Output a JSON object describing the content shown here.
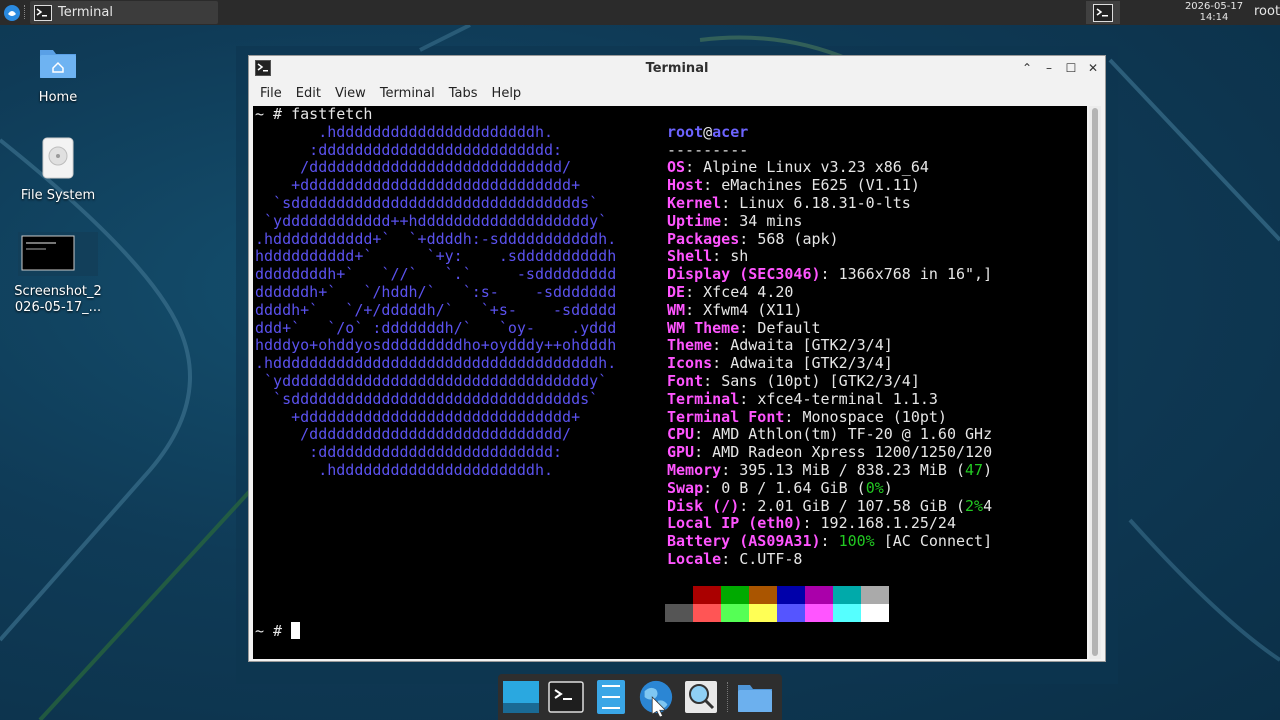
{
  "top_panel": {
    "task_title": "Terminal",
    "clock_date": "2026-05-17",
    "clock_time": "14:14",
    "user": "root"
  },
  "desktop_icons": [
    {
      "label": "Home",
      "icon": "home-folder-icon"
    },
    {
      "label": "File System",
      "icon": "drive-icon"
    },
    {
      "label": "Screenshot_2\n026-05-17_...",
      "icon": "screenshot-thumbnail"
    }
  ],
  "window": {
    "title": "Terminal",
    "menu": [
      "File",
      "Edit",
      "View",
      "Terminal",
      "Tabs",
      "Help"
    ]
  },
  "terminal": {
    "prompt": "~ #",
    "command": "fastfetch",
    "logo_lines": [
      "       .hddddddddddddddddddddddh.",
      "      :dddddddddddddddddddddddddd:",
      "     /dddddddddddddddddddddddddddd/",
      "    +dddddddddddddddddddddddddddddd+",
      "  `sdddddddddddddddddddddddddddddddds`",
      " `ydddddddddddd++hdddddddddddddddddddy`",
      ".hddddddddddd+`  `+ddddh:-sdddddddddddh.",
      "hdddddddddd+`      `+y:    .sddddddddddh",
      "ddddddddh+`   `//`   `.`     -sddddddddd",
      "ddddddh+`   `/hddh/`   `:s-    -sddddddd",
      "ddddh+`   `/+/dddddh/`   `+s-    -sddddd",
      "ddd+`   `/o` :dddddddh/`   `oy-    .yddd",
      "hdddyo+ohddyosdddddddddho+oydddy++ohdddh",
      ".hddddddddddddddddddddddddddddddddddddh.",
      " `yddddddddddddddddddddddddddddddddddy`",
      "  `sdddddddddddddddddddddddddddddddds`",
      "    +dddddddddddddddddddddddddddddd+",
      "     /dddddddddddddddddddddddddddd/",
      "      :dddddddddddddddddddddddddd:",
      "       .hddddddddddddddddddddddh."
    ],
    "user_host": {
      "user": "root",
      "at": "@",
      "host": "acer"
    },
    "dashes": "---------",
    "info": [
      {
        "key": "OS",
        "value": "Alpine Linux v3.23 x86_64"
      },
      {
        "key": "Host",
        "value": "eMachines E625 (V1.11)"
      },
      {
        "key": "Kernel",
        "value": "Linux 6.18.31-0-lts"
      },
      {
        "key": "Uptime",
        "value": "34 mins"
      },
      {
        "key": "Packages",
        "value": "568 (apk)"
      },
      {
        "key": "Shell",
        "value": "sh"
      },
      {
        "key": "Display (SEC3046)",
        "value": "1366x768 in 16\",]"
      },
      {
        "key": "DE",
        "value": "Xfce4 4.20"
      },
      {
        "key": "WM",
        "value": "Xfwm4 (X11)"
      },
      {
        "key": "WM Theme",
        "value": "Default"
      },
      {
        "key": "Theme",
        "value": "Adwaita [GTK2/3/4]"
      },
      {
        "key": "Icons",
        "value": "Adwaita [GTK2/3/4]"
      },
      {
        "key": "Font",
        "value": "Sans (10pt) [GTK2/3/4]"
      },
      {
        "key": "Terminal",
        "value": "xfce4-terminal 1.1.3"
      },
      {
        "key": "Terminal Font",
        "value": "Monospace (10pt)"
      },
      {
        "key": "CPU",
        "value": "AMD Athlon(tm) TF-20 @ 1.60 GHz"
      },
      {
        "key": "GPU",
        "value": "AMD Radeon Xpress 1200/1250/120"
      }
    ],
    "memory": {
      "key": "Memory",
      "value": "395.13 MiB / 838.23 MiB (",
      "pct": "47",
      "tail": ")"
    },
    "swap": {
      "key": "Swap",
      "value": "0 B / 1.64 GiB (",
      "pct": "0%",
      "tail": ")"
    },
    "disk": {
      "key": "Disk (/)",
      "value": "2.01 GiB / 107.58 GiB (",
      "pct": "2%",
      "tail": "4"
    },
    "local_ip": {
      "key": "Local IP (eth0)",
      "value": "192.168.1.25/24"
    },
    "battery": {
      "key": "Battery (AS09A31)",
      "pct": "100%",
      "value": "[AC Connect]"
    },
    "locale": {
      "key": "Locale",
      "value": "C.UTF-8"
    },
    "palette": [
      "#000000",
      "#aa0000",
      "#00aa00",
      "#aa5500",
      "#0000aa",
      "#aa00aa",
      "#00aaaa",
      "#aaaaaa",
      "#555555",
      "#ff5555",
      "#55ff55",
      "#ffff55",
      "#5555ff",
      "#ff55ff",
      "#55ffff",
      "#ffffff"
    ],
    "final_prompt": "~ #"
  },
  "dock_items": [
    "show-desktop-icon",
    "terminal-icon",
    "file-manager-icon",
    "web-browser-icon",
    "app-finder-icon",
    "folder-icon"
  ],
  "colors": {
    "logo": "#5b52ee",
    "key": "#ff55ff",
    "green": "#22c922"
  }
}
